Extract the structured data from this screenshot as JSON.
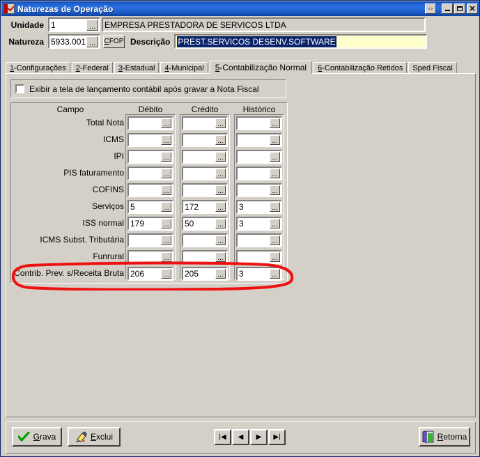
{
  "window": {
    "title": "Naturezas de Operação",
    "icon": "checkmark-red-icon",
    "buttons": {
      "move": "⇔",
      "minimize": "minimize-icon",
      "maximize": "maximize-icon",
      "close": "✕"
    }
  },
  "header": {
    "unidade_label": "Unidade",
    "unidade_value": "1",
    "unidade_ellipsis": "...",
    "empresa_value": "EMPRESA PRESTADORA DE SERVICOS LTDA",
    "natureza_label": "Natureza",
    "natureza_value": "5933.001",
    "natureza_ellipsis": "...",
    "cfop_button": "CFOP",
    "cfop_mnemonic": "C",
    "descricao_label": "Descrição",
    "descricao_value": "PREST.SERVICOS DESENV.SOFTWARE"
  },
  "tabs": [
    {
      "mnemonic": "1",
      "label": "-Configurações",
      "active": false
    },
    {
      "mnemonic": "2",
      "label": "-Federal",
      "active": false
    },
    {
      "mnemonic": "3",
      "label": "-Estadual",
      "active": false
    },
    {
      "mnemonic": "4",
      "label": "-Municipal",
      "active": false
    },
    {
      "mnemonic": "5",
      "label": "-Contabilização Normal",
      "active": true
    },
    {
      "mnemonic": "6",
      "label": "-Contabilização Retidos",
      "active": false
    },
    {
      "mnemonic": "",
      "label": "Sped Fiscal",
      "active": false
    }
  ],
  "checkbox": {
    "checked": false,
    "label_pre": "Exibir a tela de lançamento contábil após ",
    "label_mnemonic": "g",
    "label_post": "ravar a Nota Fiscal"
  },
  "grid": {
    "label_column_header": "Campo",
    "columns": [
      "Débito",
      "Crédito",
      "Histórico"
    ],
    "ellipsis": "...",
    "rows": [
      {
        "label": "Total Nota",
        "debito": "",
        "credito": "",
        "historico": "",
        "highlighted": false
      },
      {
        "label": "ICMS",
        "debito": "",
        "credito": "",
        "historico": "",
        "highlighted": false
      },
      {
        "label": "IPI",
        "debito": "",
        "credito": "",
        "historico": "",
        "highlighted": false
      },
      {
        "label": "PIS faturamento",
        "debito": "",
        "credito": "",
        "historico": "",
        "highlighted": false
      },
      {
        "label": "COFINS",
        "debito": "",
        "credito": "",
        "historico": "",
        "highlighted": false
      },
      {
        "label": "Serviços",
        "debito": "5",
        "credito": "172",
        "historico": "3",
        "highlighted": false
      },
      {
        "label": "ISS normal",
        "debito": "179",
        "credito": "50",
        "historico": "3",
        "highlighted": false
      },
      {
        "label": "ICMS Subst. Tributária",
        "debito": "",
        "credito": "",
        "historico": "",
        "highlighted": false
      },
      {
        "label": "Funrural",
        "debito": "",
        "credito": "",
        "historico": "",
        "highlighted": false
      },
      {
        "label": "Contrib. Prev. s/Receita Bruta",
        "debito": "206",
        "credito": "205",
        "historico": "3",
        "highlighted": true
      }
    ]
  },
  "annotation": {
    "shape": "hand-drawn-ellipse",
    "color": "#ee1111",
    "targets_row": "Contrib. Prev. s/Receita Bruta"
  },
  "footer": {
    "grava": {
      "label": "Grava",
      "mnemonic": "G",
      "rest": "rava",
      "icon": "green-check-icon"
    },
    "exclui": {
      "label": "Exclui",
      "mnemonic": "E",
      "rest": "xclui",
      "icon": "eraser-icon"
    },
    "retorna": {
      "label": "Retorna",
      "mnemonic": "R",
      "rest": "etorna",
      "icon": "open-door-icon"
    },
    "nav": [
      {
        "name": "first",
        "glyph": "|◀"
      },
      {
        "name": "previous",
        "glyph": "◀"
      },
      {
        "name": "next",
        "glyph": "▶"
      },
      {
        "name": "last",
        "glyph": "▶|"
      }
    ]
  },
  "colors": {
    "window_face": "#d4d0c8",
    "title_blue": "#1b5fd0",
    "field_highlight": "#ffffcc",
    "selection_navy": "#0a246a",
    "annotation_red": "#ee1111"
  }
}
